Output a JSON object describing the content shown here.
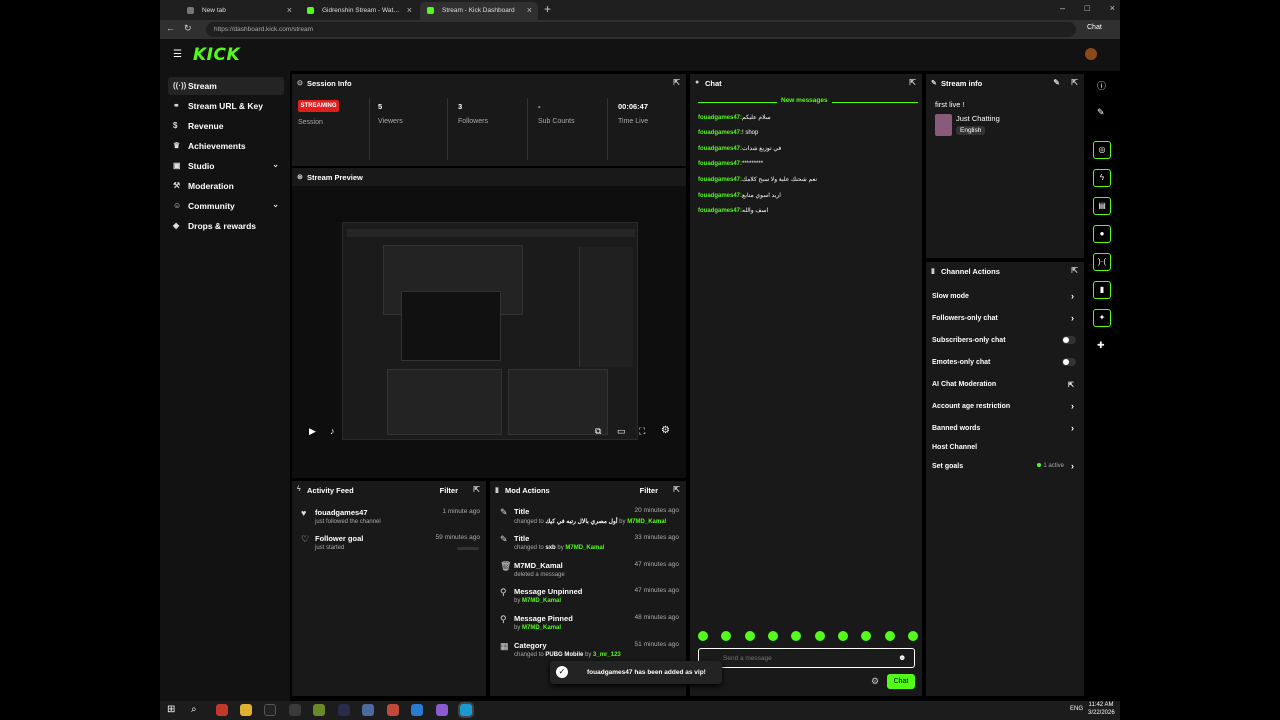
{
  "browser": {
    "tabs": [
      {
        "title": "New tab"
      },
      {
        "title": "Gidrenshin Stream - Watch Li..."
      },
      {
        "title": "Stream - Kick Dashboard"
      }
    ],
    "url": "https://dashboard.kick.com/stream",
    "chat_label": "Chat"
  },
  "brand": {
    "logo": "KICK",
    "accent": "#53fc18"
  },
  "sidebar": {
    "items": [
      {
        "label": "Stream",
        "icon": "signal-icon"
      },
      {
        "label": "Stream URL & Key",
        "icon": "link-icon"
      },
      {
        "label": "Revenue",
        "icon": "dollar-icon"
      },
      {
        "label": "Achievements",
        "icon": "trophy-icon"
      },
      {
        "label": "Studio",
        "icon": "video-icon"
      },
      {
        "label": "Moderation",
        "icon": "hammer-icon"
      },
      {
        "label": "Community",
        "icon": "people-icon"
      },
      {
        "label": "Drops & rewards",
        "icon": "gift-icon"
      }
    ]
  },
  "session": {
    "title": "Session Info",
    "status": "STREAMING",
    "status_label": "Session",
    "stats": [
      {
        "value": "5",
        "label": "Viewers"
      },
      {
        "value": "3",
        "label": "Followers"
      },
      {
        "value": "-",
        "label": "Sub Counts"
      },
      {
        "value": "00:06:47",
        "label": "Time Live"
      }
    ]
  },
  "preview": {
    "title": "Stream Preview"
  },
  "chat": {
    "title": "Chat",
    "new_messages": "New messages",
    "messages": [
      {
        "user": "fouadgames47:",
        "text": "سلام عليكم"
      },
      {
        "user": "fouadgames47:",
        "text": "! shop"
      },
      {
        "user": "fouadgames47:",
        "text": "في توزيع شدات"
      },
      {
        "user": "fouadgames47:",
        "text": "*********"
      },
      {
        "user": "fouadgames47:",
        "text": "نعم شحنك علبة ولا سبح كلامك"
      },
      {
        "user": "fouadgames47:",
        "text": "اريد اسوي متابع"
      },
      {
        "user": "fouadgames47:",
        "text": "اسف والله"
      }
    ],
    "placeholder": "Send a message",
    "send_label": "Chat"
  },
  "stream_info": {
    "title": "Stream info",
    "stream_title": "first live !",
    "category": "Just Chatting",
    "language": "English"
  },
  "channel_actions": {
    "title": "Channel Actions",
    "items": [
      {
        "label": "Slow mode"
      },
      {
        "label": "Followers-only chat"
      },
      {
        "label": "Subscribers-only chat"
      },
      {
        "label": "Emotes-only chat"
      },
      {
        "label": "AI Chat Moderation"
      },
      {
        "label": "Account age restriction"
      },
      {
        "label": "Banned words"
      },
      {
        "label": "Host Channel"
      },
      {
        "label": "Set goals",
        "status": "1 active"
      }
    ]
  },
  "activity": {
    "title": "Activity Feed",
    "filter": "Filter",
    "items": [
      {
        "title": "fouadgames47",
        "sub": "just followed the channel",
        "time": "1 minute ago",
        "icon": "heart-icon"
      },
      {
        "title": "Follower goal",
        "sub": "just started",
        "time": "59 minutes ago",
        "icon": "heart-outline-icon"
      }
    ]
  },
  "mod": {
    "title": "Mod Actions",
    "filter": "Filter",
    "items": [
      {
        "title": "Title",
        "pre": "changed to ",
        "val": "أول مصري بالال رتبه في كيك",
        "by": " by ",
        "user": "M7MD_Kamal",
        "time": "20 minutes ago"
      },
      {
        "title": "Title",
        "pre": "changed to ",
        "val": "sxb",
        "by": " by ",
        "user": "M7MD_Kamal",
        "time": "33 minutes ago"
      },
      {
        "title": "M7MD_Kamal",
        "pre": "deleted a message",
        "val": "",
        "by": "",
        "user": "",
        "time": "47 minutes ago"
      },
      {
        "title": "Message Unpinned",
        "pre": "by ",
        "val": "",
        "by": "",
        "user": "M7MD_Kamal",
        "time": "47 minutes ago"
      },
      {
        "title": "Message Pinned",
        "pre": "by ",
        "val": "",
        "by": "",
        "user": "M7MD_Kamal",
        "time": "48 minutes ago"
      },
      {
        "title": "Category",
        "pre": "changed to ",
        "val": "PUBG Mobile",
        "by": " by ",
        "user": "3_mr_123",
        "time": "51 minutes ago"
      }
    ]
  },
  "toast": {
    "text": "fouadgames47 has been added as vip!"
  },
  "clock": {
    "time": "11:42 AM",
    "date": "3/22/2026",
    "lang": "ENG"
  }
}
